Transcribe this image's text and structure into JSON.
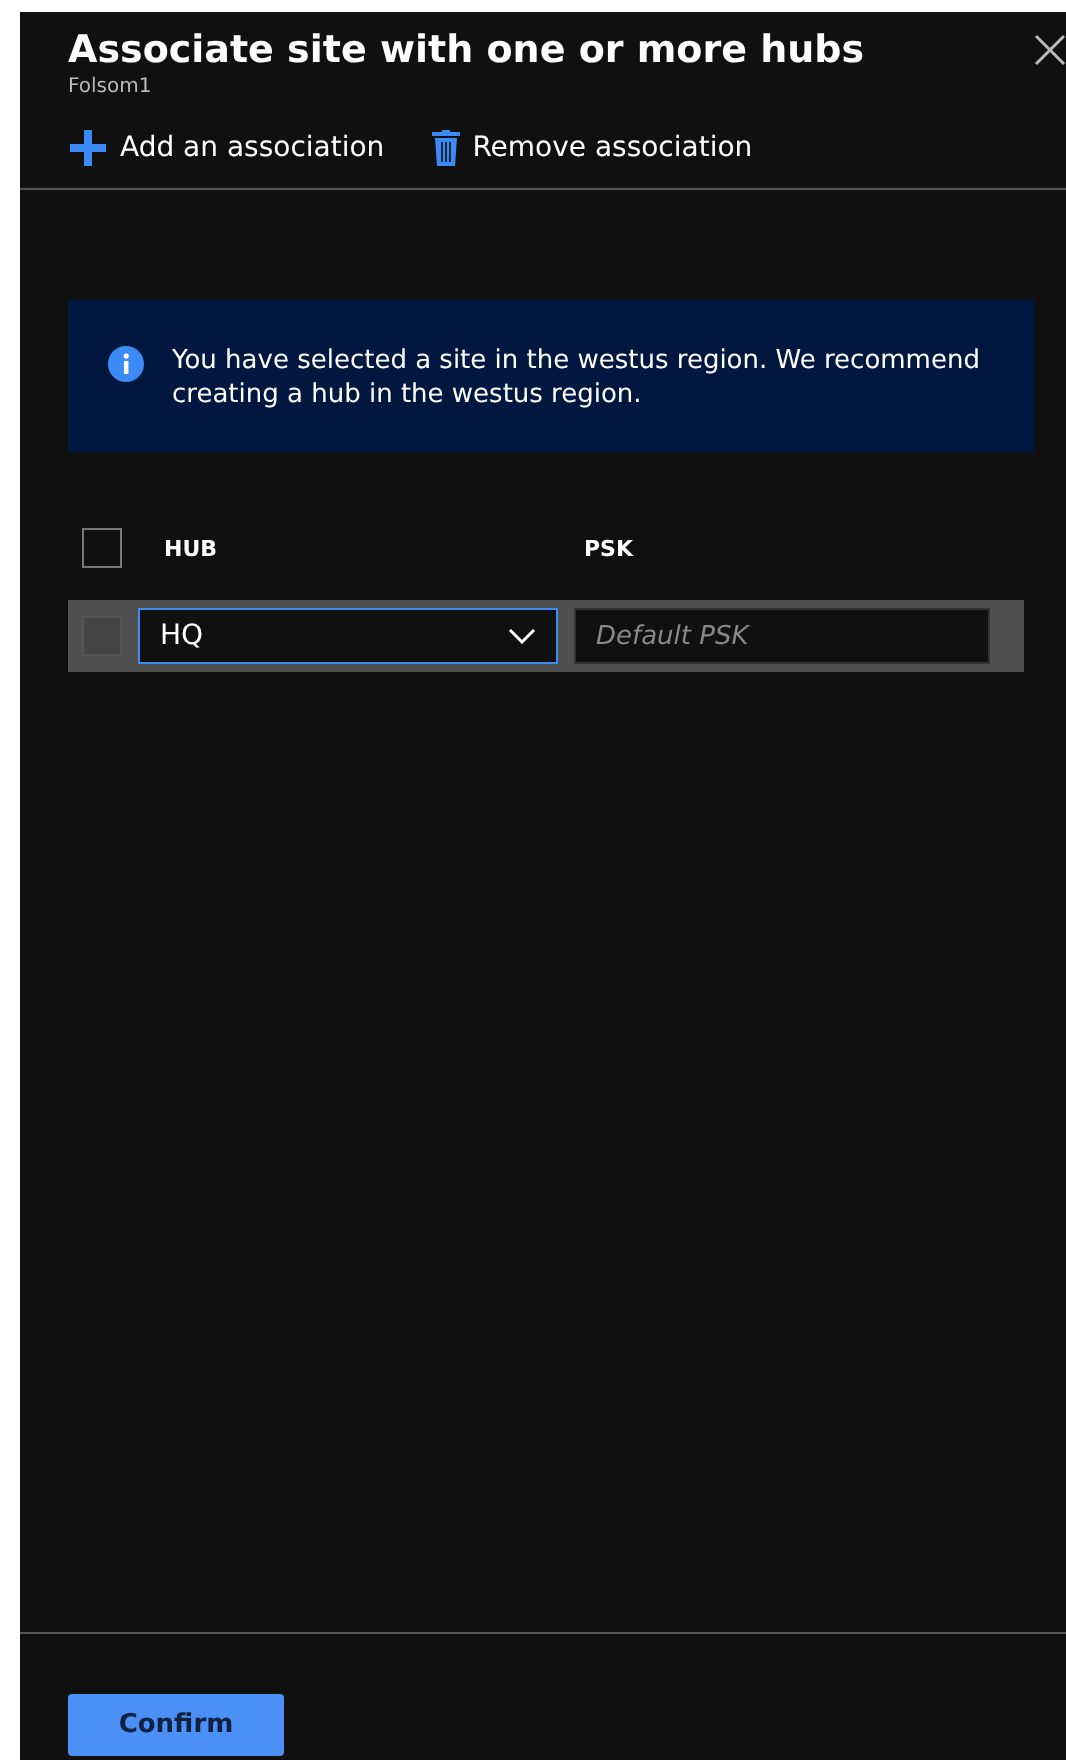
{
  "panel": {
    "title": "Associate site with one or more hubs",
    "subtitle": "Folsom1"
  },
  "toolbar": [
    {
      "kind": "add",
      "label": "Add an association"
    },
    {
      "kind": "remove",
      "label": "Remove association"
    }
  ],
  "info": {
    "message": "You have selected a site in the westus region. We recommend creating a hub in the westus region."
  },
  "table": {
    "select_all_checked": false,
    "columns": [
      "HUB",
      "PSK"
    ],
    "rows": [
      {
        "checked": false,
        "hub": "HQ",
        "psk_placeholder": "Default PSK"
      }
    ]
  },
  "buttons": [
    {
      "label": "Confirm"
    }
  ]
}
